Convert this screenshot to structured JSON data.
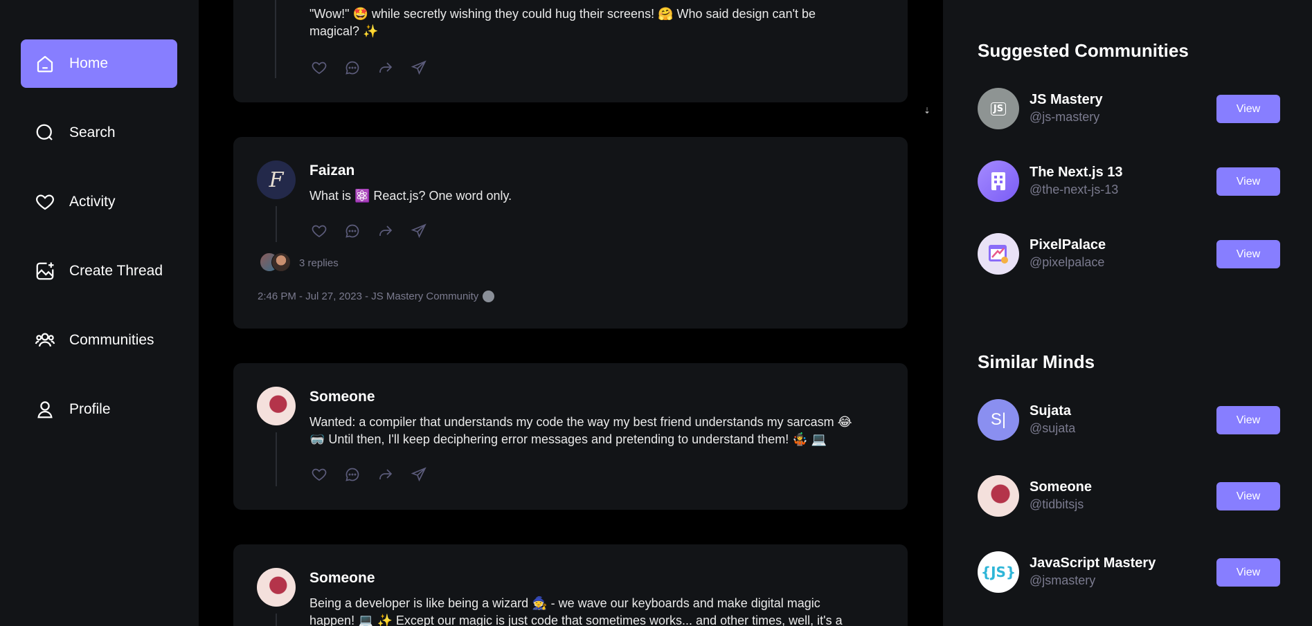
{
  "sidebar": {
    "items": [
      {
        "label": "Home",
        "icon": "home-icon",
        "active": true
      },
      {
        "label": "Search",
        "icon": "search-icon"
      },
      {
        "label": "Activity",
        "icon": "heart-icon"
      },
      {
        "label": "Create Thread",
        "icon": "image-plus-icon"
      },
      {
        "label": "Communities",
        "icon": "users-icon"
      },
      {
        "label": "Profile",
        "icon": "user-icon"
      }
    ]
  },
  "feed": {
    "threads": [
      {
        "author": "",
        "content_line1": "\"Wow!\" 🤩 while secretly wishing they could hug their screens! 🤗 Who said design can't be",
        "content_line2": "magical? ✨"
      },
      {
        "author": "Faizan",
        "avatar_letter": "F",
        "content_line1": "What is ⚛️ React.js? One word only.",
        "replies": "3 replies",
        "meta": "2:46 PM - Jul 27, 2023 - JS Mastery Community"
      },
      {
        "author": "Someone",
        "content_line1": "Wanted: a compiler that understands my code the way my best friend understands my sarcasm 😂",
        "content_line2": "🥽 Until then, I'll keep deciphering error messages and pretending to understand them! 🤹 💻"
      },
      {
        "author": "Someone",
        "content_line1": "Being a developer is like being a wizard 🧙 - we wave our keyboards and make digital magic",
        "content_line2": "happen! 💻 ✨ Except our magic is just code that sometimes works... and other times, well, it's a"
      }
    ]
  },
  "right_sidebar": {
    "suggested_title": "Suggested Communities",
    "communities": [
      {
        "name": "JS Mastery",
        "handle": "@js-mastery",
        "button": "View"
      },
      {
        "name": "The Next.js 13",
        "handle": "@the-next-js-13",
        "button": "View"
      },
      {
        "name": "PixelPalace",
        "handle": "@pixelpalace",
        "button": "View"
      }
    ],
    "similar_title": "Similar Minds",
    "users": [
      {
        "name": "Sujata",
        "handle": "@sujata",
        "button": "View",
        "avatar_text": "S|"
      },
      {
        "name": "Someone",
        "handle": "@tidbitsjs",
        "button": "View"
      },
      {
        "name": "JavaScript Mastery",
        "handle": "@jsmastery",
        "button": "View"
      }
    ]
  },
  "colors": {
    "accent": "#877eff",
    "panel": "#121417",
    "muted": "#7b7b8f"
  }
}
